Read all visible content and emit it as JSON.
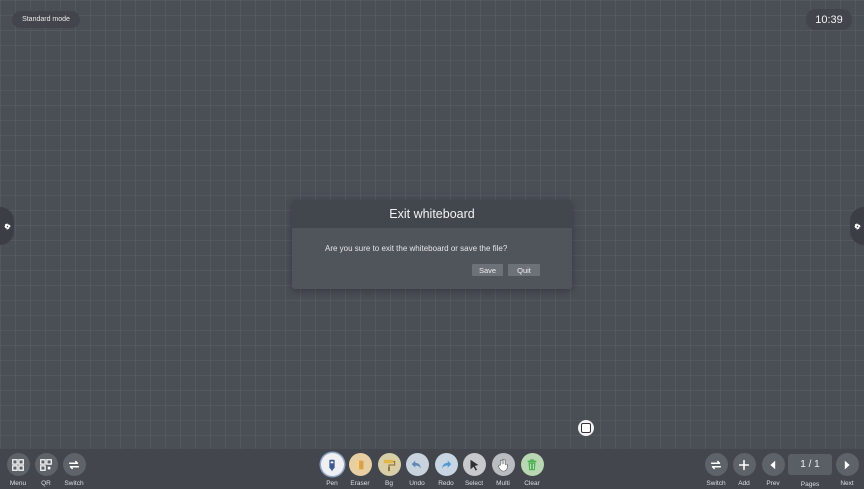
{
  "header": {
    "mode": "Standard mode",
    "time": "10:39"
  },
  "dialog": {
    "title": "Exit whiteboard",
    "message": "Are you sure to exit the whiteboard or save the file?",
    "save_label": "Save",
    "quit_label": "Quit"
  },
  "toolbar": {
    "left": [
      {
        "label": "Menu",
        "icon": "menu-grid-icon"
      },
      {
        "label": "QR",
        "icon": "qr-icon"
      },
      {
        "label": "Switch",
        "icon": "switch-icon"
      }
    ],
    "center": [
      {
        "label": "Pen",
        "icon": "pen-icon",
        "color": "#3b5a8f"
      },
      {
        "label": "Eraser",
        "icon": "eraser-icon",
        "color": "#d9a24a"
      },
      {
        "label": "Bg",
        "icon": "paint-roller-icon",
        "color": "#e0b84a"
      },
      {
        "label": "Undo",
        "icon": "undo-icon",
        "color": "#5d86b7"
      },
      {
        "label": "Redo",
        "icon": "redo-icon",
        "color": "#4f9ad1"
      },
      {
        "label": "Select",
        "icon": "select-arrow-icon",
        "color": "#2f3033"
      },
      {
        "label": "Multi",
        "icon": "multi-touch-hand-icon",
        "color": "#ffffff"
      },
      {
        "label": "Clear",
        "icon": "trash-icon",
        "color": "#4caf50"
      }
    ],
    "right": [
      {
        "label": "Switch",
        "icon": "switch-icon"
      },
      {
        "label": "Add",
        "icon": "plus-icon"
      },
      {
        "label": "Prev",
        "icon": "prev-arrow-icon"
      },
      {
        "label": "Next",
        "icon": "next-arrow-icon"
      }
    ],
    "pages": {
      "label": "Pages",
      "value": "1 / 1"
    }
  }
}
